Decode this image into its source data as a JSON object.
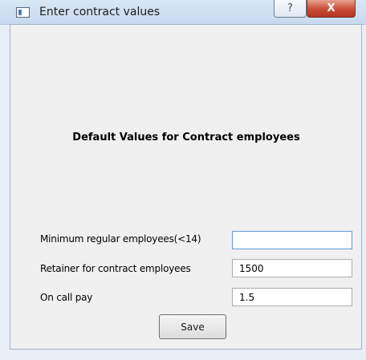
{
  "window": {
    "title": "Enter contract values",
    "help_label": "?",
    "close_label": "X"
  },
  "form": {
    "heading": "Default Values for Contract employees",
    "fields": [
      {
        "label": "Minimum regular employees(<14)",
        "value": ""
      },
      {
        "label": "Retainer for contract employees",
        "value": "1500"
      },
      {
        "label": "On call pay",
        "value": "1.5"
      }
    ],
    "save_label": "Save"
  }
}
